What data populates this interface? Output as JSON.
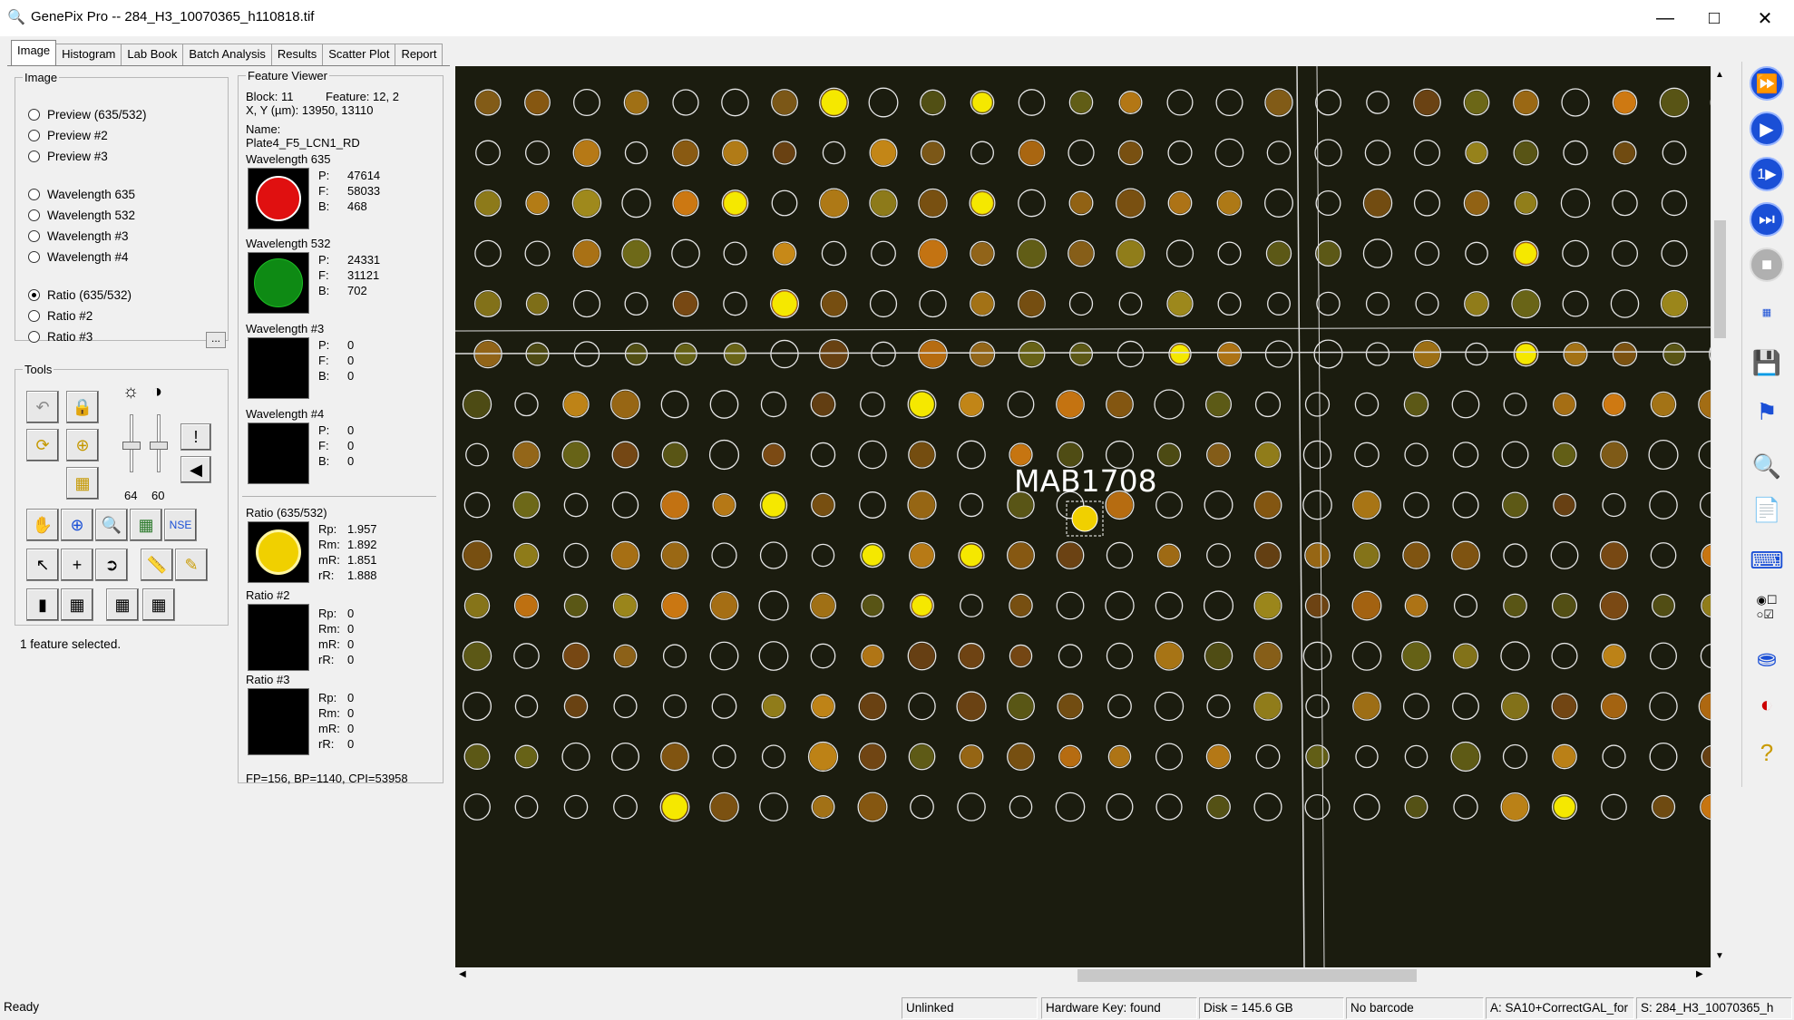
{
  "window": {
    "title": "GenePix Pro -- 284_H3_10070365_h110818.tif",
    "minimize_glyph": "—",
    "maximize_glyph": "□",
    "close_glyph": "✕"
  },
  "tabs": [
    "Image",
    "Histogram",
    "Lab Book",
    "Batch Analysis",
    "Results",
    "Scatter Plot",
    "Report"
  ],
  "image_group": {
    "legend": "Image",
    "options": [
      {
        "label": "Preview (635/532)",
        "checked": false
      },
      {
        "label": "Preview #2",
        "checked": false
      },
      {
        "label": "Preview #3",
        "checked": false
      },
      {
        "label": "Wavelength 635",
        "checked": false
      },
      {
        "label": "Wavelength 532",
        "checked": false
      },
      {
        "label": "Wavelength #3",
        "checked": false
      },
      {
        "label": "Wavelength #4",
        "checked": false
      },
      {
        "label": "Ratio (635/532)",
        "checked": true
      },
      {
        "label": "Ratio #2",
        "checked": false
      },
      {
        "label": "Ratio #3",
        "checked": false
      }
    ],
    "more_button": "..."
  },
  "tools": {
    "legend": "Tools",
    "brightness_value": "64",
    "contrast_value": "60",
    "selection_status": "1 feature selected."
  },
  "feature_viewer": {
    "legend": "Feature Viewer",
    "block_line": "Block: 11",
    "feature_line": "Feature:  12, 2",
    "xy_line": "X, Y (µm): 13950, 13110",
    "name_label": "Name:",
    "name_value": "Plate4_F5_LCN1_RD",
    "wavelengths": [
      {
        "title": "Wavelength 635",
        "p": "47614",
        "f": "58033",
        "b": "468"
      },
      {
        "title": "Wavelength 532",
        "p": "24331",
        "f": "31121",
        "b": "702"
      },
      {
        "title": "Wavelength #3",
        "p": "0",
        "f": "0",
        "b": "0"
      },
      {
        "title": "Wavelength #4",
        "p": "0",
        "f": "0",
        "b": "0"
      }
    ],
    "ratios": [
      {
        "title": "Ratio (635/532)",
        "rp": "1.957",
        "rm": "1.892",
        "mr": "1.851",
        "rr": "1.888"
      },
      {
        "title": "Ratio #2",
        "rp": "0",
        "rm": "0",
        "mr": "0",
        "rr": "0"
      },
      {
        "title": "Ratio #3",
        "rp": "0",
        "rm": "0",
        "mr": "0",
        "rr": "0"
      }
    ],
    "labels": {
      "p": "P:",
      "f": "F:",
      "b": "B:",
      "rp": "Rp:",
      "rm": "Rm:",
      "mr": "mR:",
      "rr": "rR:"
    },
    "footer": "FP=156, BP=1140, CPI=53958"
  },
  "image_view": {
    "feature_label": "MAB1708"
  },
  "status_bar": {
    "ready": "Ready",
    "link": "Unlinked",
    "hardware_key": "Hardware Key: found",
    "disk": "Disk = 145.6 GB",
    "barcode": "No barcode",
    "gal": "A: SA10+CorrectGAL_for",
    "settings": "S: 284_H3_10070365_h"
  },
  "colors": {
    "scan_background": "#1b1c0f",
    "toolbar_blue": "#1a4fd6"
  }
}
